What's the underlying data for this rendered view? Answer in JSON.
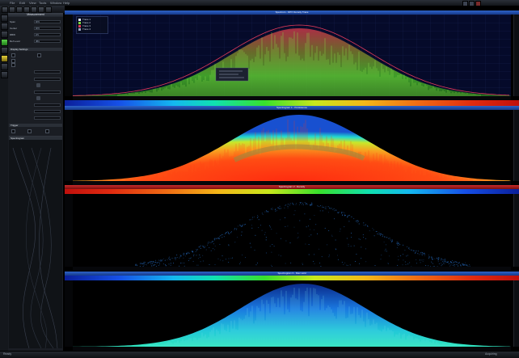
{
  "menubar": {
    "items": [
      "File",
      "Edit",
      "View",
      "Tools",
      "Window",
      "Help"
    ]
  },
  "panel": {
    "title": "Measurement",
    "rows": [
      {
        "label": "Span",
        "value": "MHz"
      },
      {
        "label": "Center",
        "value": "MHz"
      },
      {
        "label": "RBW",
        "value": "kHz"
      },
      {
        "label": "Ref Level",
        "value": "dBm"
      }
    ],
    "section2": "Display Settings",
    "section3": "Trigger",
    "section4": "Spectrogram"
  },
  "colors": {
    "accent": "#2e63c8",
    "trace": "#7ad23a",
    "envelope": "#c8344a"
  },
  "views": [
    {
      "title": "Spectrum - DPX Density Trace"
    },
    {
      "title": "Spectrogram 1 - Persistence"
    },
    {
      "title": "Spectrogram 2 - Density"
    },
    {
      "title": "Spectrogram 3 - Max Hold"
    }
  ],
  "legend": {
    "items": [
      "Trace 1",
      "Trace 2",
      "Trace 3",
      "Trace 4"
    ]
  },
  "status": {
    "left": "Ready",
    "right": "Acquiring"
  }
}
